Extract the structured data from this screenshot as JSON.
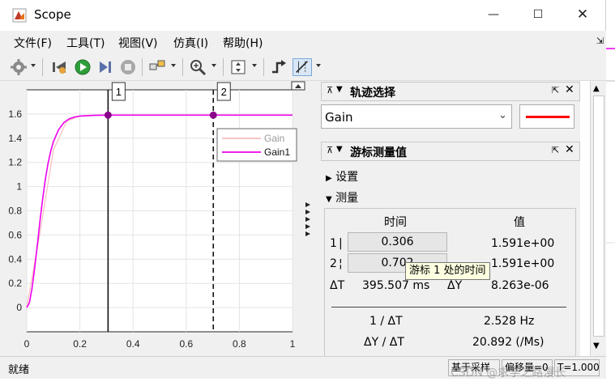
{
  "window": {
    "title": "Scope",
    "minimize": "—",
    "maximize": "☐",
    "close": "✕"
  },
  "menu": [
    "文件(F)",
    "工具(T)",
    "视图(V)",
    "仿真(I)",
    "帮助(H)"
  ],
  "plot": {
    "yticks": [
      "1.6",
      "1.4",
      "1.2",
      "1",
      "0.8",
      "0.6",
      "0.4",
      "0.2",
      "0"
    ],
    "xticks": [
      "0",
      "0.2",
      "0.4",
      "0.6",
      "0.8",
      "1"
    ],
    "cursor_labels": [
      "1",
      "2"
    ],
    "legend": [
      "Gain",
      "Gain1"
    ]
  },
  "chart_data": {
    "type": "line",
    "xlim": [
      0,
      1
    ],
    "ylim": [
      -0.2,
      1.8
    ],
    "grid": true,
    "legend_position": "top-right",
    "series": [
      {
        "name": "Gain",
        "color": "#f8bcbc",
        "x": [
          0,
          0.05,
          0.1,
          0.15,
          0.2,
          0.3,
          0.4,
          0.6,
          0.8,
          1.0
        ],
        "values": [
          0,
          0.62,
          1.3,
          1.54,
          1.585,
          1.591,
          1.591,
          1.591,
          1.591,
          1.591
        ]
      },
      {
        "name": "Gain1",
        "color": "#ee00ee",
        "x": [
          0,
          0.01,
          0.02,
          0.03,
          0.04,
          0.05,
          0.06,
          0.07,
          0.08,
          0.09,
          0.1,
          0.12,
          0.14,
          0.16,
          0.18,
          0.2,
          0.25,
          0.3,
          0.4,
          0.5,
          0.6,
          0.7,
          0.8,
          0.9,
          1.0
        ],
        "values": [
          0,
          0.04,
          0.16,
          0.33,
          0.52,
          0.72,
          0.9,
          1.06,
          1.19,
          1.29,
          1.37,
          1.47,
          1.53,
          1.56,
          1.575,
          1.583,
          1.589,
          1.591,
          1.591,
          1.591,
          1.591,
          1.591,
          1.591,
          1.591,
          1.591
        ]
      }
    ],
    "cursors": [
      {
        "label": "1",
        "x": 0.306,
        "y": 1.591,
        "style": "solid"
      },
      {
        "label": "2",
        "x": 0.702,
        "y": 1.591,
        "style": "dashed"
      }
    ]
  },
  "trace_panel": {
    "title": "轨迹选择",
    "selected": "Gain",
    "color": "#ff0000"
  },
  "cursor_panel": {
    "title": "游标测量值",
    "settings_label": "设置",
    "measure_label": "测量",
    "col_time": "时间",
    "col_value": "值",
    "row1_label": "1",
    "row1_time": "0.306",
    "row1_value": "1.591e+00",
    "row2_label": "2",
    "row2_time": "0.702",
    "row2_value": "1.591e+00",
    "dt_label": "ΔT",
    "dt_value": "395.507 ms",
    "dy_label": "ΔY",
    "dy_value": "8.263e-06",
    "inv_dt_label": "1 / ΔT",
    "inv_dt_value": "2.528 Hz",
    "dy_dt_label": "ΔY / ΔT",
    "dy_dt_value": "20.892 (/Ms)"
  },
  "tooltip": "游标 1 处的时间",
  "status": {
    "ready": "就绪",
    "sample": "基于采样",
    "offset": "偏移量=0",
    "time": "T=1.000"
  },
  "watermark": "CSDN @求学之路漫长"
}
